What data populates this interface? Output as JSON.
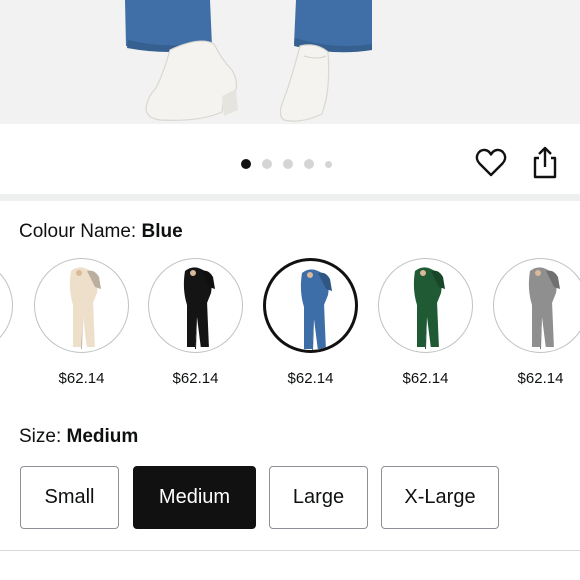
{
  "gallery": {
    "dot_count": 5,
    "active_index": 0,
    "favorite_icon": "heart-outline-icon",
    "share_icon": "share-icon"
  },
  "colour": {
    "label": "Colour Name: ",
    "selected": "Blue",
    "swatches": [
      {
        "name": "partial-left",
        "color": "#cfcfcf",
        "price": ""
      },
      {
        "name": "Beige",
        "color": "#eedfcb",
        "price": "$62.14"
      },
      {
        "name": "Black",
        "color": "#141414",
        "price": "$62.14"
      },
      {
        "name": "Blue",
        "color": "#3e6ea8",
        "price": "$62.14",
        "selected": true
      },
      {
        "name": "Green",
        "color": "#1f5a34",
        "price": "$62.14"
      },
      {
        "name": "Grey",
        "color": "#8f8f8f",
        "price": "$62.14"
      }
    ]
  },
  "size": {
    "label": "Size: ",
    "selected": "Medium",
    "options": [
      "Small",
      "Medium",
      "Large",
      "X-Large"
    ]
  }
}
